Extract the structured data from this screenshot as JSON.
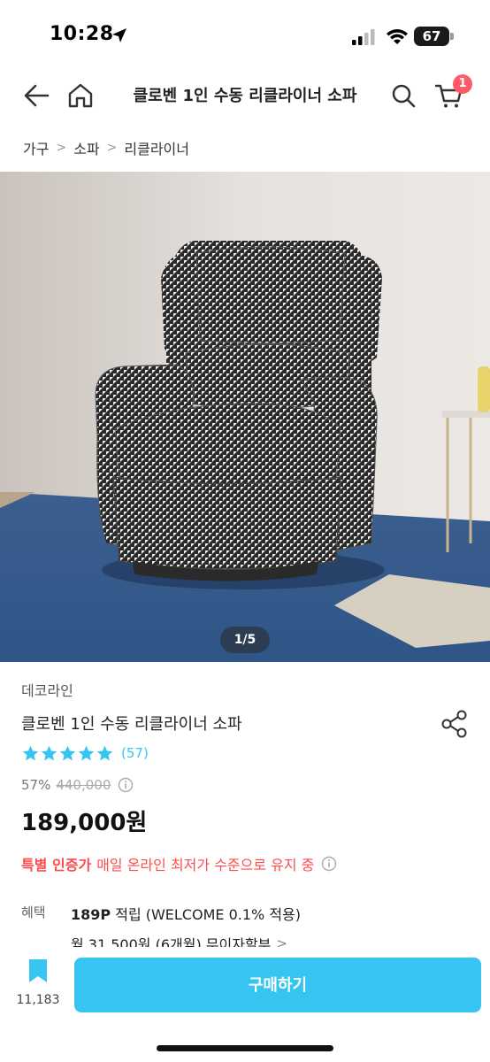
{
  "status": {
    "time": "10:28",
    "battery": "67"
  },
  "nav": {
    "title": "클로벤 1인 수동 리클라이너 소파",
    "cart_count": "1",
    "icons": [
      "back-arrow-icon",
      "home-icon",
      "search-icon",
      "cart-icon"
    ]
  },
  "breadcrumb": [
    "가구",
    "소파",
    "리클라이너"
  ],
  "gallery": {
    "indicator": "1/5"
  },
  "product": {
    "brand": "데코라인",
    "name": "클로벤 1인 수동 리클라이너 소파",
    "rating_stars": 5,
    "review_count": "(57)",
    "discount_rate": "57%",
    "original_price": "440,000",
    "sale_price": "189,000원",
    "special_tag": "특별 인증가",
    "special_text": "매일 온라인 최저가 수준으로 유지 중"
  },
  "benefit": {
    "label": "혜택",
    "points": "189P",
    "points_text": "적립 (WELCOME 0.1% 적용)",
    "installment": "월 31,500원 (6개월) 무이자할부"
  },
  "bottom_bar": {
    "bookmark_count": "11,183",
    "buy_label": "구매하기"
  },
  "colors": {
    "accent": "#35c5f0",
    "special": "#ff4b4b",
    "badge": "#ff5a67"
  }
}
